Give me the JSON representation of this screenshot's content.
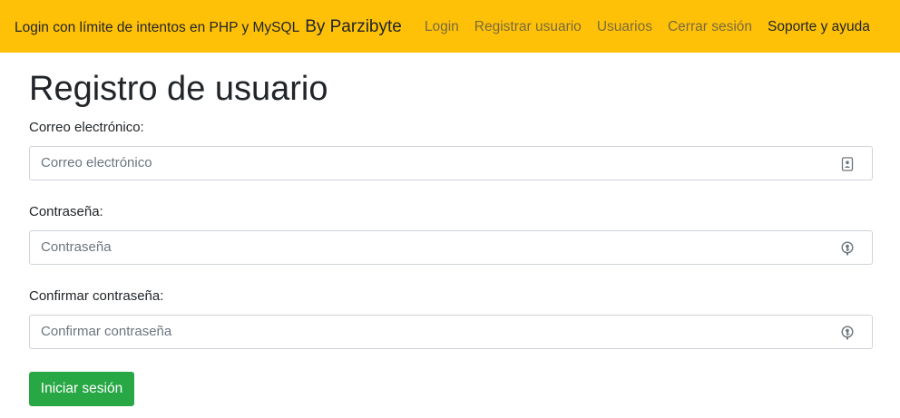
{
  "navbar": {
    "brand": "Login con límite de intentos en PHP y MySQL",
    "brand_by": "By Parzibyte",
    "links": [
      "Login",
      "Registrar usuario",
      "Usuarios",
      "Cerrar sesión",
      "Soporte y ayuda"
    ],
    "background": "#ffc107"
  },
  "page": {
    "title": "Registro de usuario"
  },
  "form": {
    "email": {
      "label": "Correo electrónico:",
      "placeholder": "Correo electrónico",
      "value": "",
      "icon": "contact-card-icon"
    },
    "password": {
      "label": "Contraseña:",
      "placeholder": "Contraseña",
      "value": "",
      "icon": "password-key-icon"
    },
    "confirm_password": {
      "label": "Confirmar contraseña:",
      "placeholder": "Confirmar contraseña",
      "value": "",
      "icon": "password-key-icon"
    },
    "submit_label": "Iniciar sesión",
    "submit_color": "#28a745"
  }
}
